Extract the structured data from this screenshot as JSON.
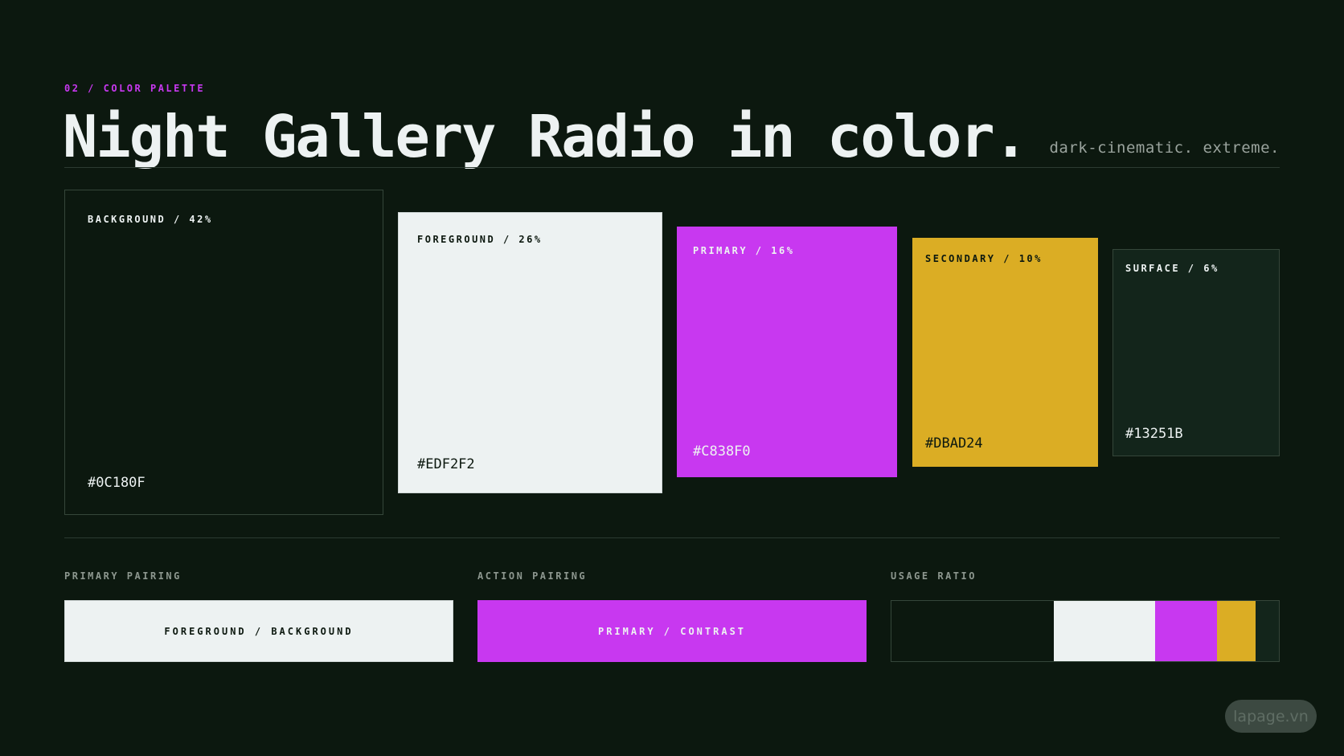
{
  "header": {
    "eyebrow": "02 / COLOR PALETTE",
    "title": "Night Gallery Radio in color.",
    "tagline": "dark-cinematic. extreme."
  },
  "swatches": [
    {
      "label": "BACKGROUND / 42%",
      "hex": "#0C180F",
      "color": "#0C180F",
      "share": 42
    },
    {
      "label": "FOREGROUND / 26%",
      "hex": "#EDF2F2",
      "color": "#EDF2F2",
      "share": 26
    },
    {
      "label": "PRIMARY / 16%",
      "hex": "#C838F0",
      "color": "#C838F0",
      "share": 16
    },
    {
      "label": "SECONDARY / 10%",
      "hex": "#DBAD24",
      "color": "#DBAD24",
      "share": 10
    },
    {
      "label": "SURFACE / 6%",
      "hex": "#13251B",
      "color": "#13251B",
      "share": 6
    }
  ],
  "pairings": {
    "primary": {
      "section_label": "PRIMARY PAIRING",
      "sample": "FOREGROUND / BACKGROUND"
    },
    "action": {
      "section_label": "ACTION PAIRING",
      "sample": "PRIMARY / CONTRAST"
    }
  },
  "usage": {
    "section_label": "USAGE RATIO",
    "segments": [
      {
        "color": "#0C180F",
        "share": 42
      },
      {
        "color": "#EDF2F2",
        "share": 26
      },
      {
        "color": "#C838F0",
        "share": 16
      },
      {
        "color": "#DBAD24",
        "share": 10
      },
      {
        "color": "#13251B",
        "share": 6
      }
    ]
  },
  "watermark": "lapage.vn"
}
